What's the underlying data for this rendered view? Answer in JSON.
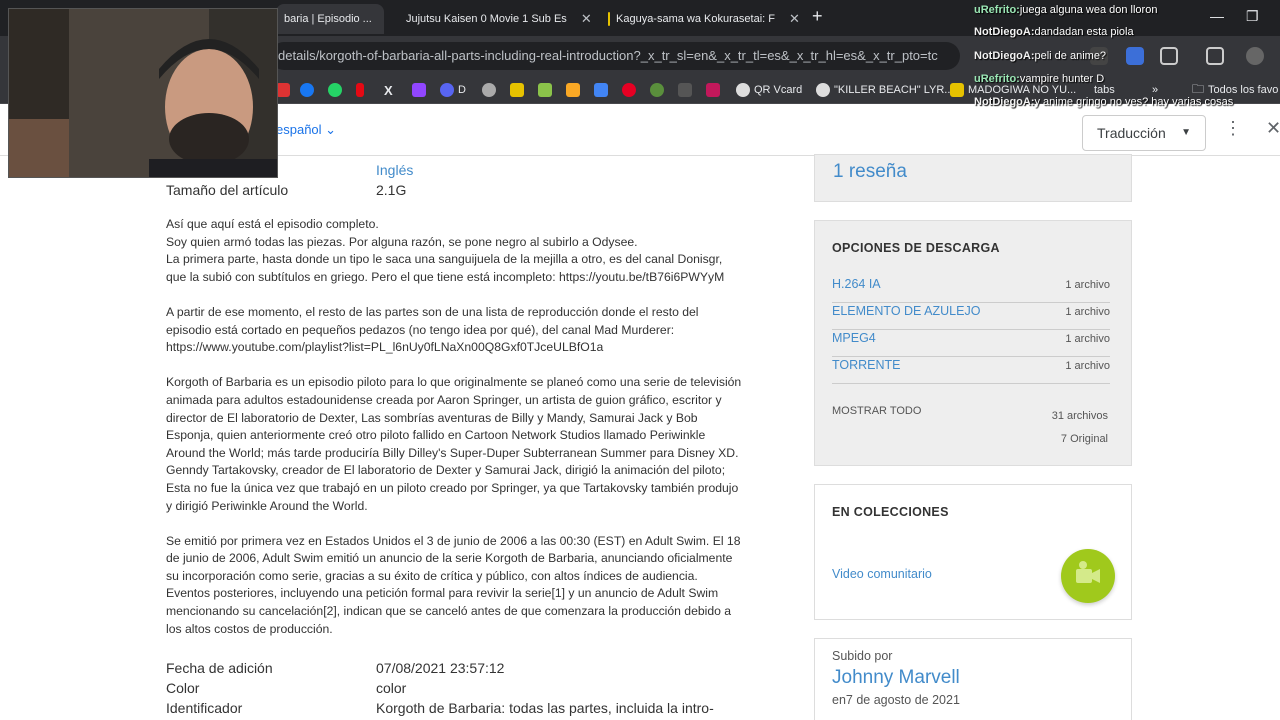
{
  "browser": {
    "tabs": [
      {
        "title": "baria | Episodio ..."
      },
      {
        "title": "Jujutsu Kaisen 0 Movie 1 Sub Es"
      },
      {
        "title": "Kaguya-sama wa Kokurasetai: F"
      }
    ],
    "url": "details/korgoth-of-barbaria-all-parts-including-real-introduction?_x_tr_sl=en&_x_tr_tl=es&_x_tr_hl=es&_x_tr_pto=tc",
    "bookmarks": [
      {
        "label": "QR Vcard"
      },
      {
        "label": "\"KILLER BEACH\" LYR..."
      },
      {
        "label": "MADOGIWA NO YU..."
      },
      {
        "label": "tabs"
      },
      {
        "label": "Todos los favo"
      }
    ],
    "bookmark_d": "D"
  },
  "translate": {
    "language": "español",
    "button_label": "Traducción"
  },
  "meta_top": [
    {
      "key": "",
      "value": "Inglés"
    },
    {
      "key": "Tamaño del artículo",
      "value": "2.1G"
    }
  ],
  "description": {
    "p1": [
      "Así que aquí está el episodio completo.",
      "Soy quien armó todas las piezas. Por alguna razón, se pone negro al subirlo a Odysee.",
      "La primera parte, hasta donde un tipo le saca una sanguijuela de la mejilla a otro, es del canal Donisgr,",
      "que la subió con subtítulos en griego. Pero el que tiene está incompleto: https://youtu.be/tB76i6PWYyM"
    ],
    "p2": [
      "A partir de ese momento, el resto de las partes son de una lista de reproducción donde el resto del",
      "episodio está cortado en pequeños pedazos (no tengo idea por qué), del canal Mad Murderer:",
      "https://www.youtube.com/playlist?list=PL_l6nUy0fLNaXn00Q8Gxf0TJceULBfO1a"
    ],
    "p3": [
      "Korgoth of Barbaria es un episodio piloto para lo que originalmente se planeó como una serie de televisión",
      "animada para adultos estadounidense creada por Aaron Springer, un artista de guion gráfico, escritor y",
      "director de El laboratorio de Dexter, Las sombrías aventuras de Billy y Mandy, Samurai Jack y Bob",
      "Esponja, quien anteriormente creó otro piloto fallido en Cartoon Network Studios llamado Periwinkle",
      "Around the World; más tarde produciría Billy Dilley's Super-Duper Subterranean Summer para Disney XD.",
      "Genndy Tartakovsky, creador de El laboratorio de Dexter y Samurai Jack, dirigió la animación del piloto;",
      "Esta no fue la única vez que trabajó en un piloto creado por Springer, ya que Tartakovsky también produjo",
      "y dirigió Periwinkle Around the World."
    ],
    "p4": [
      "Se emitió por primera vez en Estados Unidos el 3 de junio de 2006 a las 00:30 (EST) en Adult Swim. El 18",
      "de junio de 2006, Adult Swim emitió un anuncio de la serie Korgoth de Barbaria, anunciando oficialmente",
      "su incorporación como serie, gracias a su éxito de crítica y público, con altos índices de audiencia.",
      "Eventos posteriores, incluyendo una petición formal para revivir la serie[1] y un anuncio de Adult Swim",
      "mencionando su cancelación[2], indican que se canceló antes de que comenzara la producción debido a",
      "los altos costos de producción."
    ]
  },
  "meta_bottom": [
    {
      "key": "Fecha de adición",
      "value": "07/08/2021 23:57:12"
    },
    {
      "key": "Color",
      "value": "color"
    },
    {
      "key": "Identificador",
      "value": "Korgoth de Barbaria: todas las partes, incluida la intro-"
    }
  ],
  "reviews": {
    "label": "1 reseña"
  },
  "downloads": {
    "title": "OPCIONES DE DESCARGA",
    "items": [
      {
        "name": "H.264 IA",
        "count": "1 archivo"
      },
      {
        "name": "ELEMENTO DE AZULEJO",
        "count": "1 archivo"
      },
      {
        "name": "MPEG4",
        "count": "1 archivo"
      },
      {
        "name": "TORRENTE",
        "count": "1 archivo"
      }
    ],
    "show_all": "MOSTRAR TODO",
    "total_files": "31 archivos",
    "original": "7 Original"
  },
  "collections": {
    "title": "EN COLECCIONES",
    "item": "Video comunitario"
  },
  "uploader": {
    "label": "Subido por",
    "name": "Johnny Marvell",
    "date": "en7 de agosto de 2021"
  },
  "chat": [
    {
      "user": "uRefrito:",
      "text": "juega alguna wea don lloron"
    },
    {
      "user": "NotDiegoA:",
      "text": "dandadan esta piola"
    },
    {
      "user": "NotDiegoA:",
      "text": "peli de anime?"
    },
    {
      "user": "uRefrito:",
      "text": "vampire hunter D"
    },
    {
      "user": "NotDiegoA:",
      "text": "y anime gringo no ves? hay varias cosas"
    }
  ],
  "colors": {
    "link": "#428bca",
    "chrome_dark": "#202124",
    "chrome_mid": "#35363a",
    "collection_badge": "#a0c91c"
  }
}
